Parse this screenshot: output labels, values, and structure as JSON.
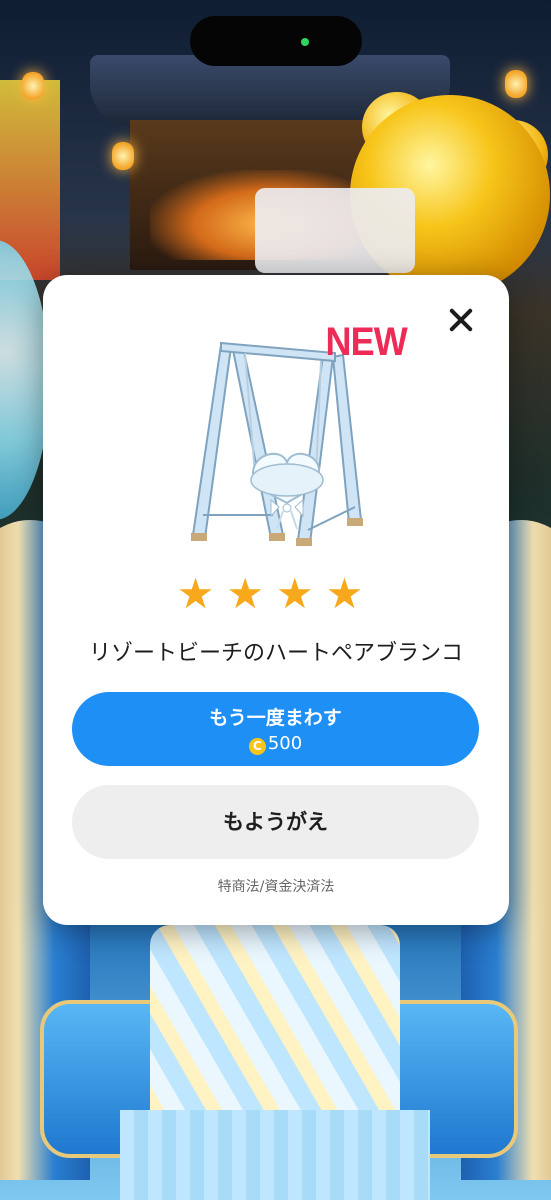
{
  "dialog": {
    "badge": "NEW",
    "rarity_stars": 4,
    "stars_text": "★★★★",
    "item_name": "リゾートビーチのハートペアブランコ",
    "spin_again_label": "もう一度まわす",
    "spin_cost": "500",
    "coin_icon_glyph": "C",
    "change_clothes_label": "もようがえ",
    "legal_link": "特商法/資金決済法"
  },
  "colors": {
    "primary_button": "#1e8ff5",
    "badge": "#ee2a57",
    "star": "#f7a81b"
  },
  "icons": [
    "close-icon",
    "coin-icon",
    "star-icon"
  ]
}
